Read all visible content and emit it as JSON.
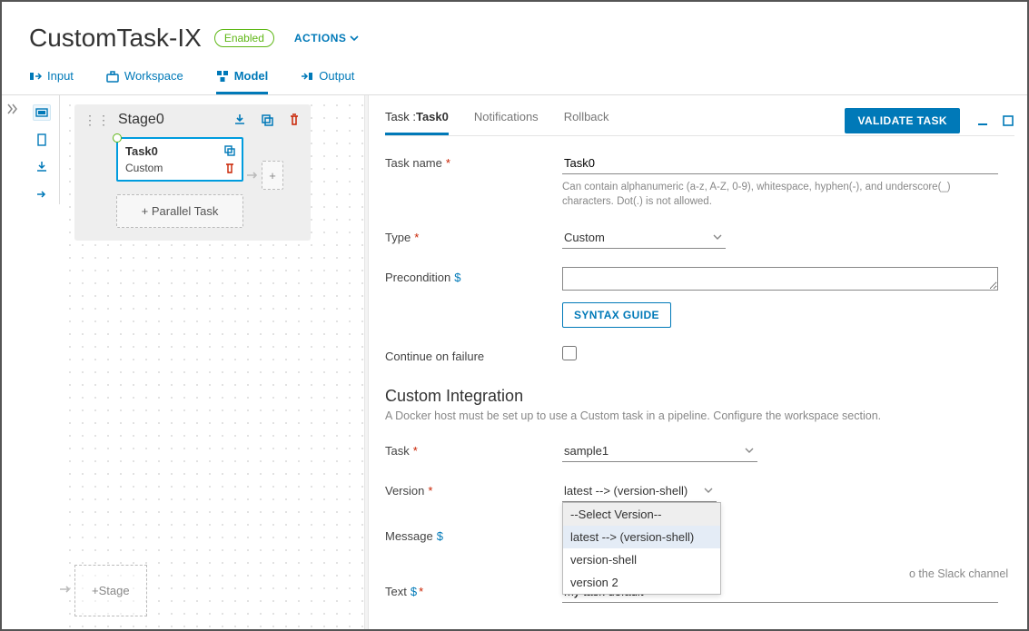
{
  "header": {
    "title": "CustomTask-IX",
    "badge": "Enabled",
    "actions_label": "ACTIONS"
  },
  "primary_tabs": {
    "input": "Input",
    "workspace": "Workspace",
    "model": "Model",
    "output": "Output"
  },
  "canvas": {
    "stage_name": "Stage0",
    "task_name": "Task0",
    "task_type": "Custom",
    "parallel_label": "+ Parallel Task",
    "add_stage_label": "+Stage"
  },
  "panel": {
    "sub_tabs": {
      "task_prefix": "Task :",
      "task_name": "Task0",
      "notifications": "Notifications",
      "rollback": "Rollback"
    },
    "validate": "VALIDATE TASK"
  },
  "form": {
    "task_name_label": "Task name",
    "task_name_value": "Task0",
    "task_name_help": "Can contain alphanumeric (a-z, A-Z, 0-9), whitespace, hyphen(-), and underscore(_) characters. Dot(.) is not allowed.",
    "type_label": "Type",
    "type_value": "Custom",
    "precondition_label": "Precondition",
    "syntax_guide": "SYNTAX GUIDE",
    "continue_label": "Continue on failure",
    "ci_title": "Custom Integration",
    "ci_sub": "A Docker host must be set up to use a Custom task in a pipeline. Configure the workspace section.",
    "task_label": "Task",
    "task_value": "sample1",
    "version_label": "Version",
    "version_value": "latest --> (version-shell)",
    "version_options": {
      "placeholder": "--Select Version--",
      "o1": "latest --> (version-shell)",
      "o2": "version-shell",
      "o3": "version 2"
    },
    "message_label": "Message",
    "message_side": "o the Slack channel",
    "text_label": "Text",
    "text_value": "my task default"
  }
}
